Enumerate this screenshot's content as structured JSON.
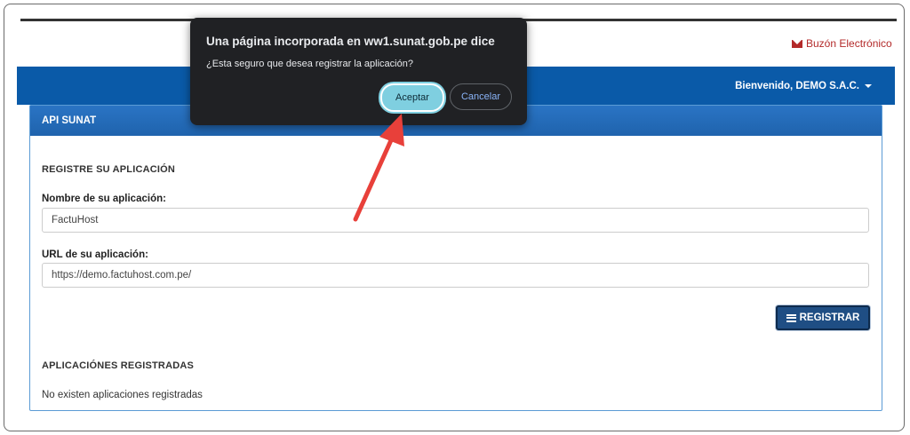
{
  "header": {
    "buzon_label": "Buzón Electrónico",
    "welcome_label": "Bienvenido, DEMO S.A.C."
  },
  "panel": {
    "title": "API SUNAT",
    "register_heading": "REGISTRE SU APLICACIÓN",
    "name_label": "Nombre de su aplicación:",
    "name_value": "FactuHost",
    "url_label": "URL de su aplicación:",
    "url_value": "https://demo.factuhost.com.pe/",
    "register_button": "REGISTRAR",
    "registered_heading": "APLICACIÓNES REGISTRADAS",
    "empty_message": "No existen aplicaciones registradas"
  },
  "dialog": {
    "title": "Una página incorporada en ww1.sunat.gob.pe dice",
    "message": "¿Esta seguro que desea registrar la aplicación?",
    "accept_label": "Aceptar",
    "cancel_label": "Cancelar"
  },
  "colors": {
    "header_bar": "#0a5aa8",
    "panel_header": "#1f63ad",
    "buzon_red": "#b32a2a",
    "dialog_bg": "#202124",
    "accept_button": "#7fcfe0",
    "annotation_arrow": "#e8403a"
  }
}
